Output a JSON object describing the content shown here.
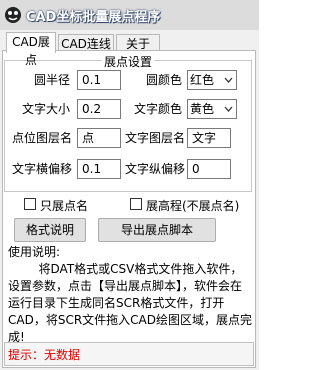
{
  "window": {
    "title": "CAD坐标批量展点程序",
    "icon": "app-icon"
  },
  "tabs": [
    {
      "label": "CAD展点",
      "active": true
    },
    {
      "label": "CAD连线",
      "active": false
    },
    {
      "label": "关于",
      "active": false
    }
  ],
  "settings": {
    "group_title": "展点设置",
    "circle_radius": {
      "label": "圆半径",
      "value": "0.1"
    },
    "circle_color": {
      "label": "圆颜色",
      "value": "红色"
    },
    "text_size": {
      "label": "文字大小",
      "value": "0.2"
    },
    "text_color": {
      "label": "文字颜色",
      "value": "黄色"
    },
    "point_layer": {
      "label": "点位图层名",
      "value": "点"
    },
    "text_layer": {
      "label": "文字图层名",
      "value": "文字"
    },
    "text_offset_x": {
      "label": "文字横偏移",
      "value": "0.1"
    },
    "text_offset_y": {
      "label": "文字纵偏移",
      "value": "0"
    }
  },
  "options": {
    "only_points": {
      "label": "只展点名",
      "checked": false
    },
    "elevation": {
      "label": "展高程(不展点名)",
      "checked": false
    }
  },
  "buttons": {
    "format_help": "格式说明",
    "export_script": "导出展点脚本"
  },
  "instructions": {
    "title": "使用说明:",
    "body": "        将DAT格式或CSV格式文件拖入软件，设置参数，点击【导出展点脚本】，软件会在运行目录下生成同名SCR格式文件，打开CAD，将SCR文件拖入CAD绘图区域，展点完成!"
  },
  "status": {
    "text": "提示：无数据",
    "color": "#e00000"
  }
}
